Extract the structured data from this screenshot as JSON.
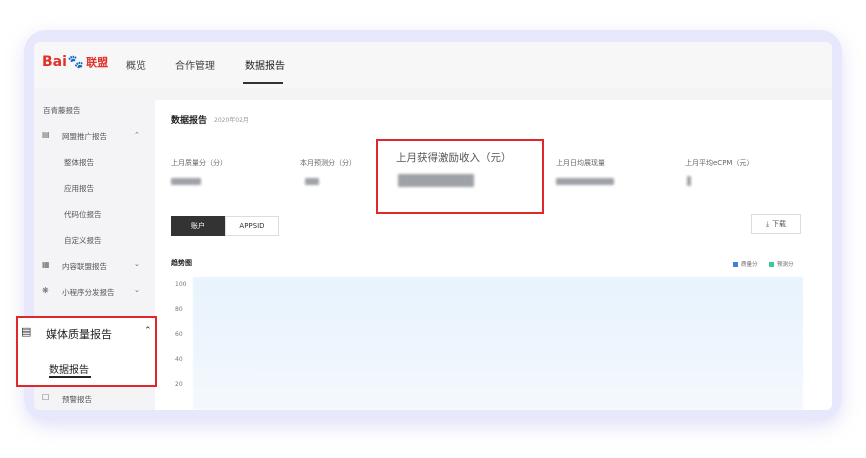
{
  "nav": {
    "logo_bai": "Bai",
    "logo_lianmeng": "联盟",
    "tabs": [
      "概览",
      "合作管理",
      "数据报告"
    ]
  },
  "sidebar": {
    "section_title": "百青藤报告",
    "groups": [
      {
        "label": "网盟推广报告",
        "children": [
          "整体报告",
          "应用报告",
          "代码位报告",
          "自定义报告"
        ]
      },
      {
        "label": "内容联盟报告"
      },
      {
        "label": "小程序分发报告"
      }
    ],
    "highlight_group": "媒体质量报告",
    "highlight_child": "数据报告",
    "bottom_item": "预警报告"
  },
  "card": {
    "title": "数据报告",
    "date": "2020年02月",
    "metrics": [
      "上月质量分（分）",
      "本月预测分（分）",
      "上月获得激励收入（元）",
      "上月日均展现量",
      "上月平均eCPM（元）"
    ],
    "btn_account": "账户",
    "btn_appsid": "APPSID",
    "btn_download": "下载",
    "trend_title": "趋势图",
    "legend": [
      {
        "label": "质量分",
        "color": "#3f7fe0"
      },
      {
        "label": "预测分",
        "color": "#3cc7a0"
      }
    ],
    "y_ticks": [
      "100",
      "80",
      "60",
      "40",
      "20"
    ]
  },
  "colors": {
    "highlight": "#e0282a",
    "frame": "#e7e8fb"
  }
}
